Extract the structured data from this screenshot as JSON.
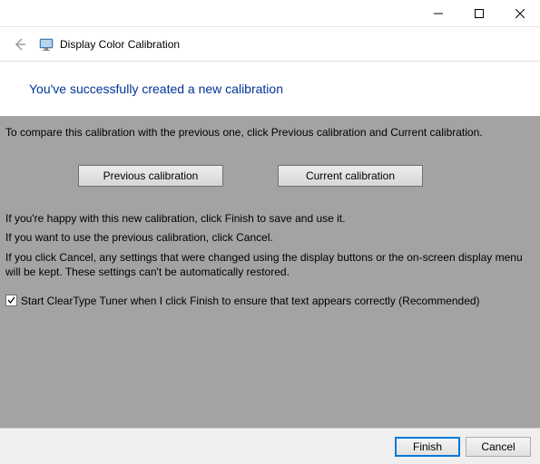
{
  "window": {
    "app_title": "Display Color Calibration"
  },
  "heading": "You've successfully created a new calibration",
  "body": {
    "compare_instruction": "To compare this calibration with the previous one, click Previous calibration and Current calibration.",
    "prev_btn": "Previous calibration",
    "curr_btn": "Current calibration",
    "happy_text": "If you're happy with this new calibration, click Finish to save and use it.",
    "cancel_text": "If you want to use the previous calibration, click Cancel.",
    "warn_text": "If you click Cancel, any settings that were changed using the display buttons or the on-screen display menu will be kept. These settings can't be automatically restored.",
    "cleartype_label": "Start ClearType Tuner when I click Finish to ensure that text appears correctly (Recommended)"
  },
  "footer": {
    "finish": "Finish",
    "cancel": "Cancel"
  }
}
